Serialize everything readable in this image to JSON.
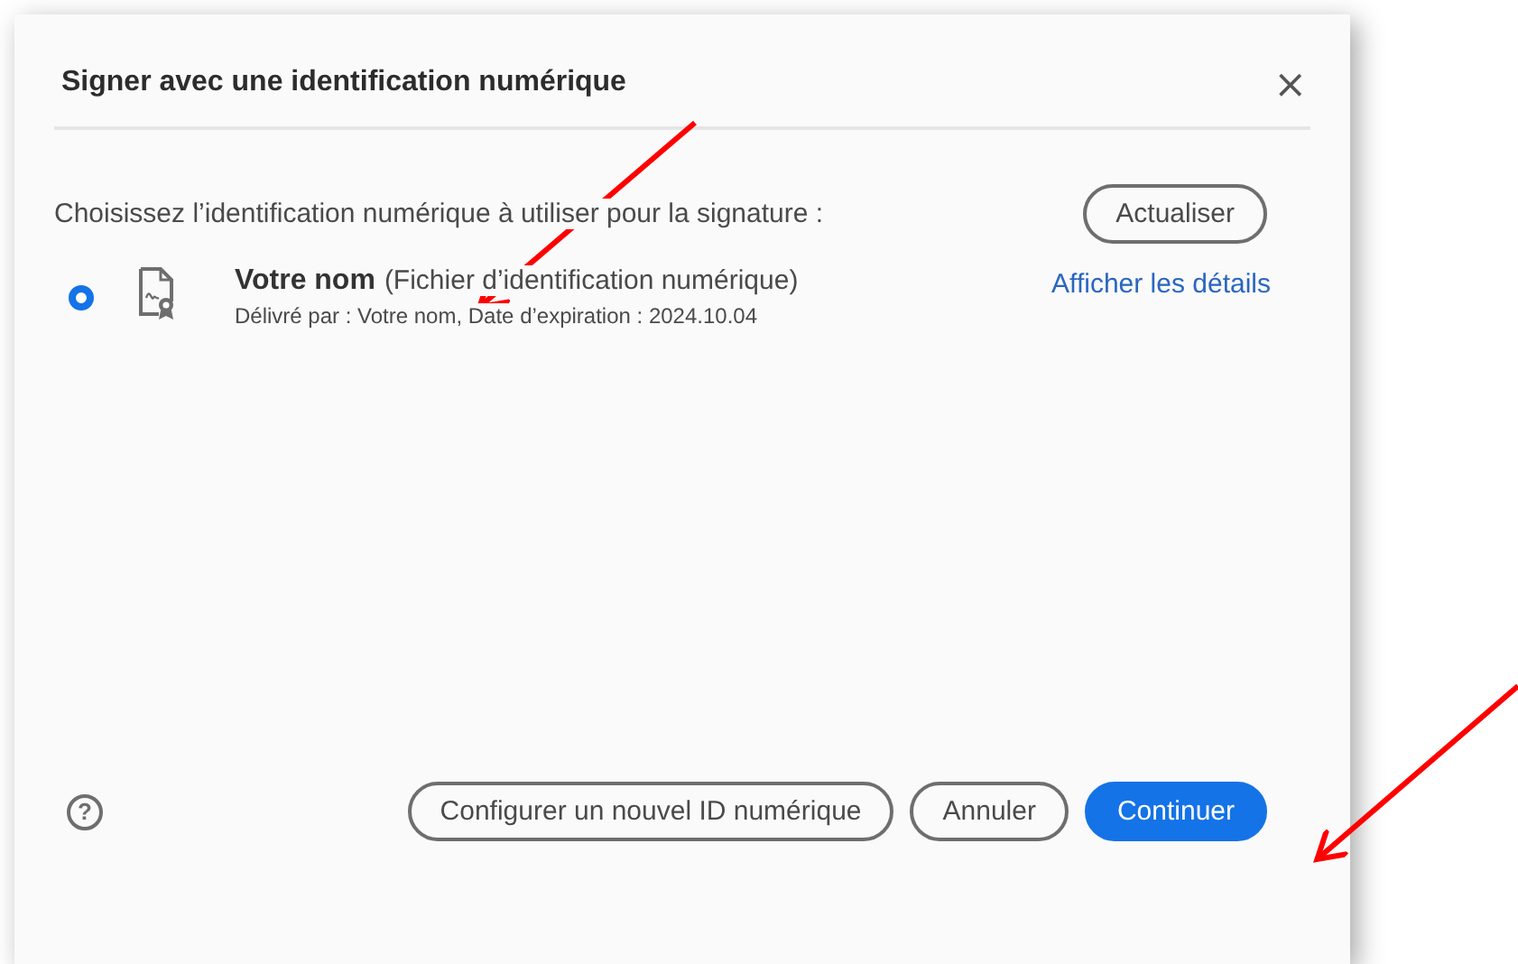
{
  "dialog": {
    "title": "Signer avec une identification numérique",
    "close": "×"
  },
  "prompt": "Choisissez l’identification numérique à utiliser pour la signature :",
  "refresh_button": "Actualiser",
  "ids": [
    {
      "name": "Votre nom",
      "type": "(Fichier d’identification numérique)",
      "details": "Délivré par : Votre nom, Date d’expiration : 2024.10.04",
      "link": "Afficher les détails",
      "selected": true
    }
  ],
  "help": "?",
  "buttons": [
    {
      "label": "Configurer un nouvel ID numérique",
      "kind": "secondary"
    },
    {
      "label": "Annuler",
      "kind": "secondary"
    },
    {
      "label": "Continuer",
      "kind": "primary"
    }
  ]
}
